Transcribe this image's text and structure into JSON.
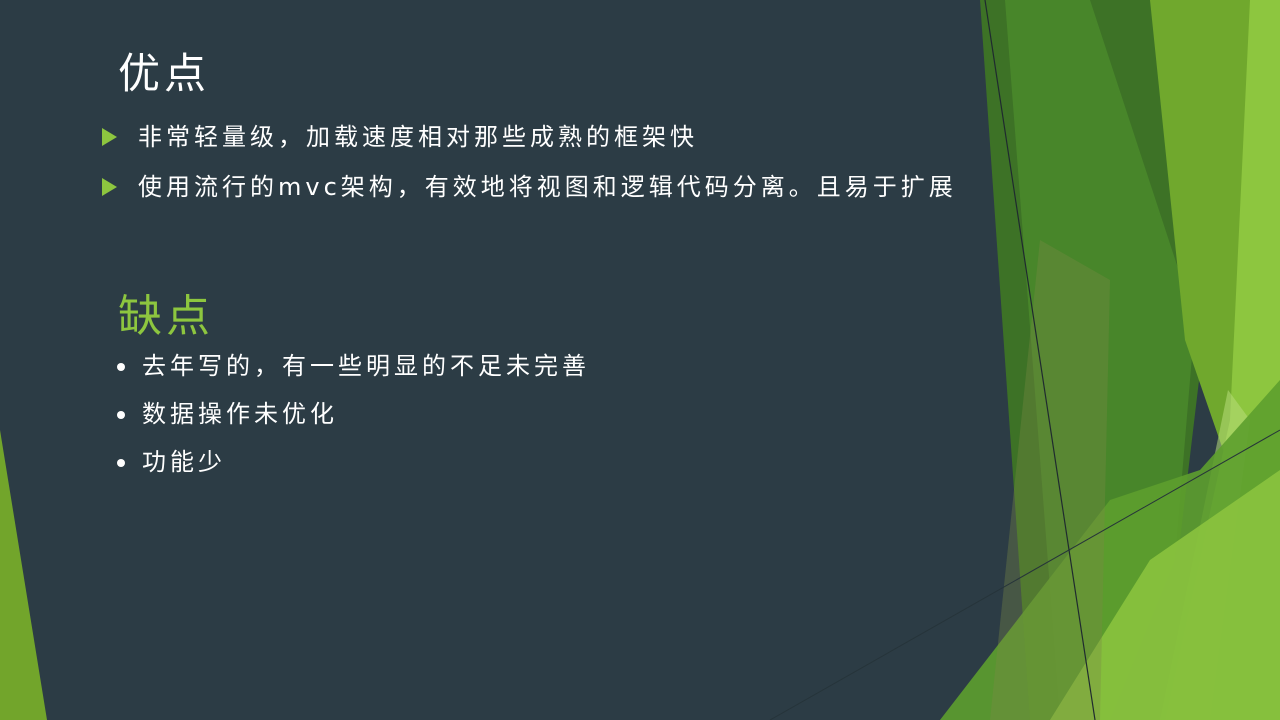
{
  "slide": {
    "pros": {
      "heading": "优点",
      "items": [
        "非常轻量级，加载速度相对那些成熟的框架快",
        "使用流行的mvc架构，有效地将视图和逻辑代码分离。且易于扩展"
      ]
    },
    "cons": {
      "heading": "缺点",
      "items": [
        "去年写的，有一些明显的不足未完善",
        "数据操作未优化",
        "功能少"
      ]
    }
  },
  "colors": {
    "background": "#2c3c45",
    "accent_green": "#8dc63f",
    "dark_green": "#3e7227",
    "mid_green": "#4f8f2c",
    "light_green": "#a5d15c",
    "text": "#ffffff"
  },
  "icons": {
    "pros_bullet": "triangle-bullet-icon",
    "cons_bullet": "dot-bullet-icon"
  }
}
